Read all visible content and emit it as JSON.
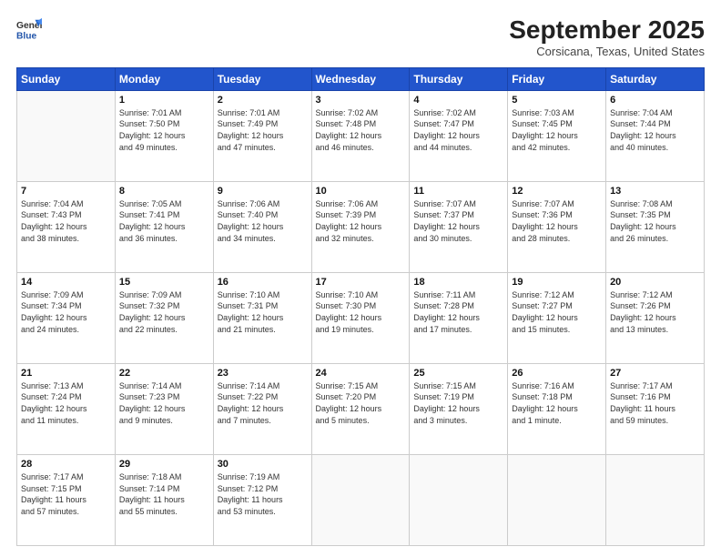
{
  "header": {
    "logo_general": "General",
    "logo_blue": "Blue",
    "month_title": "September 2025",
    "location": "Corsicana, Texas, United States"
  },
  "weekdays": [
    "Sunday",
    "Monday",
    "Tuesday",
    "Wednesday",
    "Thursday",
    "Friday",
    "Saturday"
  ],
  "weeks": [
    [
      {
        "day": "",
        "info": ""
      },
      {
        "day": "1",
        "info": "Sunrise: 7:01 AM\nSunset: 7:50 PM\nDaylight: 12 hours\nand 49 minutes."
      },
      {
        "day": "2",
        "info": "Sunrise: 7:01 AM\nSunset: 7:49 PM\nDaylight: 12 hours\nand 47 minutes."
      },
      {
        "day": "3",
        "info": "Sunrise: 7:02 AM\nSunset: 7:48 PM\nDaylight: 12 hours\nand 46 minutes."
      },
      {
        "day": "4",
        "info": "Sunrise: 7:02 AM\nSunset: 7:47 PM\nDaylight: 12 hours\nand 44 minutes."
      },
      {
        "day": "5",
        "info": "Sunrise: 7:03 AM\nSunset: 7:45 PM\nDaylight: 12 hours\nand 42 minutes."
      },
      {
        "day": "6",
        "info": "Sunrise: 7:04 AM\nSunset: 7:44 PM\nDaylight: 12 hours\nand 40 minutes."
      }
    ],
    [
      {
        "day": "7",
        "info": "Sunrise: 7:04 AM\nSunset: 7:43 PM\nDaylight: 12 hours\nand 38 minutes."
      },
      {
        "day": "8",
        "info": "Sunrise: 7:05 AM\nSunset: 7:41 PM\nDaylight: 12 hours\nand 36 minutes."
      },
      {
        "day": "9",
        "info": "Sunrise: 7:06 AM\nSunset: 7:40 PM\nDaylight: 12 hours\nand 34 minutes."
      },
      {
        "day": "10",
        "info": "Sunrise: 7:06 AM\nSunset: 7:39 PM\nDaylight: 12 hours\nand 32 minutes."
      },
      {
        "day": "11",
        "info": "Sunrise: 7:07 AM\nSunset: 7:37 PM\nDaylight: 12 hours\nand 30 minutes."
      },
      {
        "day": "12",
        "info": "Sunrise: 7:07 AM\nSunset: 7:36 PM\nDaylight: 12 hours\nand 28 minutes."
      },
      {
        "day": "13",
        "info": "Sunrise: 7:08 AM\nSunset: 7:35 PM\nDaylight: 12 hours\nand 26 minutes."
      }
    ],
    [
      {
        "day": "14",
        "info": "Sunrise: 7:09 AM\nSunset: 7:34 PM\nDaylight: 12 hours\nand 24 minutes."
      },
      {
        "day": "15",
        "info": "Sunrise: 7:09 AM\nSunset: 7:32 PM\nDaylight: 12 hours\nand 22 minutes."
      },
      {
        "day": "16",
        "info": "Sunrise: 7:10 AM\nSunset: 7:31 PM\nDaylight: 12 hours\nand 21 minutes."
      },
      {
        "day": "17",
        "info": "Sunrise: 7:10 AM\nSunset: 7:30 PM\nDaylight: 12 hours\nand 19 minutes."
      },
      {
        "day": "18",
        "info": "Sunrise: 7:11 AM\nSunset: 7:28 PM\nDaylight: 12 hours\nand 17 minutes."
      },
      {
        "day": "19",
        "info": "Sunrise: 7:12 AM\nSunset: 7:27 PM\nDaylight: 12 hours\nand 15 minutes."
      },
      {
        "day": "20",
        "info": "Sunrise: 7:12 AM\nSunset: 7:26 PM\nDaylight: 12 hours\nand 13 minutes."
      }
    ],
    [
      {
        "day": "21",
        "info": "Sunrise: 7:13 AM\nSunset: 7:24 PM\nDaylight: 12 hours\nand 11 minutes."
      },
      {
        "day": "22",
        "info": "Sunrise: 7:14 AM\nSunset: 7:23 PM\nDaylight: 12 hours\nand 9 minutes."
      },
      {
        "day": "23",
        "info": "Sunrise: 7:14 AM\nSunset: 7:22 PM\nDaylight: 12 hours\nand 7 minutes."
      },
      {
        "day": "24",
        "info": "Sunrise: 7:15 AM\nSunset: 7:20 PM\nDaylight: 12 hours\nand 5 minutes."
      },
      {
        "day": "25",
        "info": "Sunrise: 7:15 AM\nSunset: 7:19 PM\nDaylight: 12 hours\nand 3 minutes."
      },
      {
        "day": "26",
        "info": "Sunrise: 7:16 AM\nSunset: 7:18 PM\nDaylight: 12 hours\nand 1 minute."
      },
      {
        "day": "27",
        "info": "Sunrise: 7:17 AM\nSunset: 7:16 PM\nDaylight: 11 hours\nand 59 minutes."
      }
    ],
    [
      {
        "day": "28",
        "info": "Sunrise: 7:17 AM\nSunset: 7:15 PM\nDaylight: 11 hours\nand 57 minutes."
      },
      {
        "day": "29",
        "info": "Sunrise: 7:18 AM\nSunset: 7:14 PM\nDaylight: 11 hours\nand 55 minutes."
      },
      {
        "day": "30",
        "info": "Sunrise: 7:19 AM\nSunset: 7:12 PM\nDaylight: 11 hours\nand 53 minutes."
      },
      {
        "day": "",
        "info": ""
      },
      {
        "day": "",
        "info": ""
      },
      {
        "day": "",
        "info": ""
      },
      {
        "day": "",
        "info": ""
      }
    ]
  ]
}
